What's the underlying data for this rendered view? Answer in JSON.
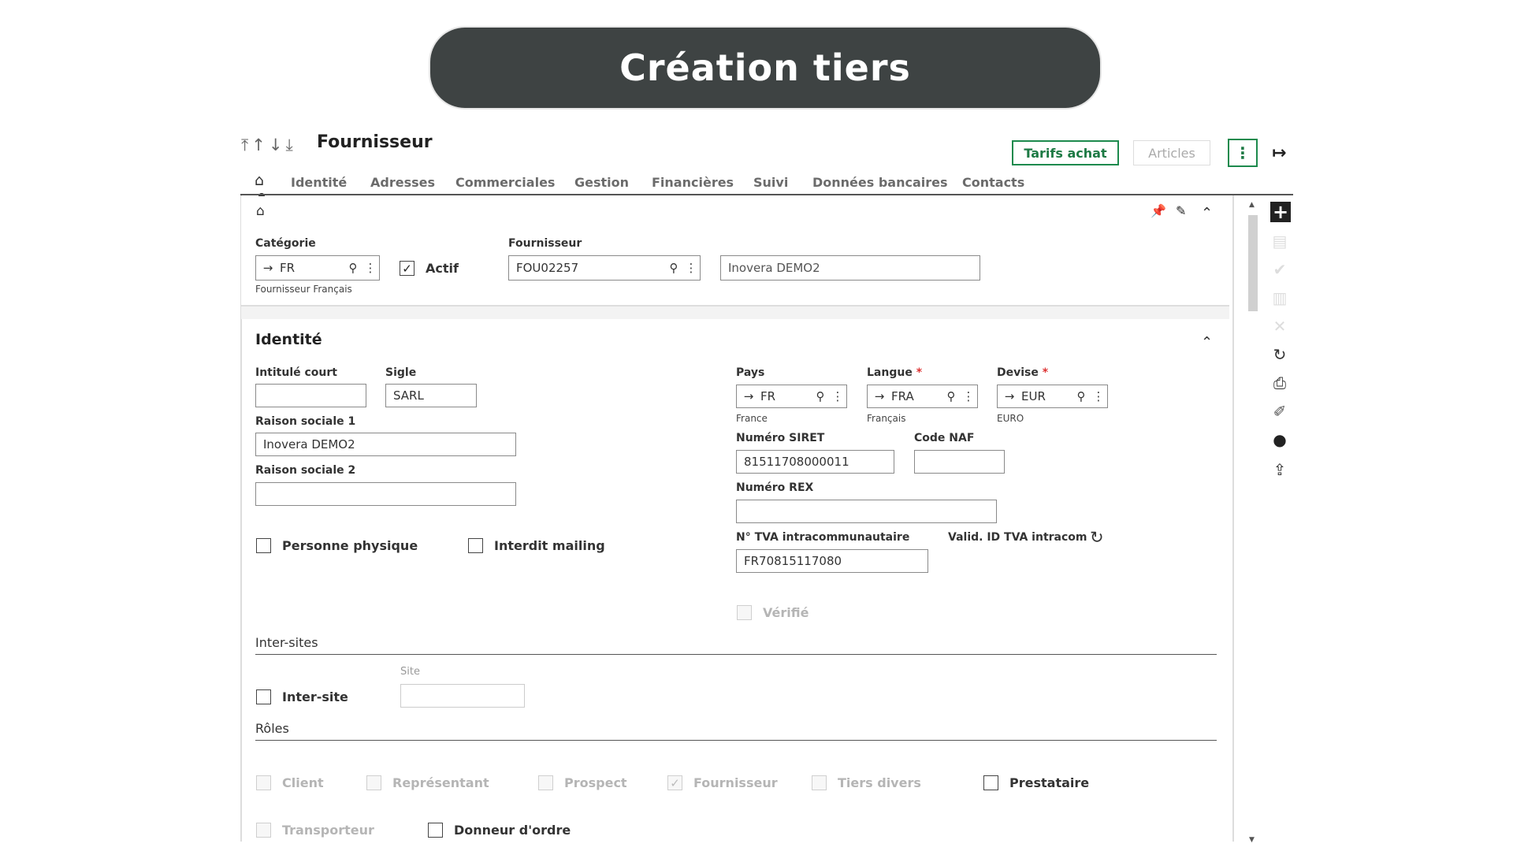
{
  "banner": {
    "title": "Création tiers"
  },
  "header": {
    "nav_arrows": "⤒↑↓⤓",
    "title": "Fournisseur",
    "tarifs_label": "Tarifs achat",
    "articles_label": "Articles",
    "more_icon": "⋮",
    "exit_icon": "↦"
  },
  "tabs": [
    "Identité",
    "Adresses",
    "Commerciales",
    "Gestion",
    "Financières",
    "Suivi",
    "Données bancaires",
    "Contacts"
  ],
  "top_card": {
    "categorie_label": "Catégorie",
    "categorie_value": "FR",
    "categorie_desc": "Fournisseur Français",
    "actif_label": "Actif",
    "actif_checked": true,
    "fournisseur_label": "Fournisseur",
    "fournisseur_value": "FOU02257",
    "fournisseur_name": "Inovera DEMO2"
  },
  "identite": {
    "title": "Identité",
    "intitule_label": "Intitulé court",
    "intitule_value": "",
    "sigle_label": "Sigle",
    "sigle_value": "SARL",
    "raison1_label": "Raison sociale 1",
    "raison1_value": "Inovera DEMO2",
    "raison2_label": "Raison sociale 2",
    "raison2_value": "",
    "personne_label": "Personne physique",
    "mailing_label": "Interdit mailing",
    "pays_label": "Pays",
    "pays_value": "FR",
    "pays_desc": "France",
    "langue_label": "Langue",
    "langue_value": "FRA",
    "langue_desc": "Français",
    "devise_label": "Devise",
    "devise_value": "EUR",
    "devise_desc": "EURO",
    "required_mark": "*",
    "siret_label": "Numéro SIRET",
    "siret_value": "81511708000011",
    "naf_label": "Code NAF",
    "naf_value": "",
    "rex_label": "Numéro REX",
    "rex_value": "",
    "tva_label": "N° TVA intracommunautaire",
    "tva_value": "FR70815117080",
    "valid_label": "Valid. ID TVA intracom",
    "verifie_label": "Vérifié"
  },
  "intersites": {
    "title": "Inter-sites",
    "site_label": "Site",
    "site_value": "",
    "intersite_label": "Inter-site"
  },
  "roles": {
    "title": "Rôles",
    "items": [
      {
        "label": "Client",
        "checked": false,
        "disabled": true
      },
      {
        "label": "Représentant",
        "checked": false,
        "disabled": true
      },
      {
        "label": "Prospect",
        "checked": false,
        "disabled": true
      },
      {
        "label": "Fournisseur",
        "checked": true,
        "disabled": true
      },
      {
        "label": "Tiers divers",
        "checked": false,
        "disabled": true
      },
      {
        "label": "Prestataire",
        "checked": false,
        "disabled": false
      },
      {
        "label": "Transporteur",
        "checked": false,
        "disabled": true
      },
      {
        "label": "Donneur d'ordre",
        "checked": false,
        "disabled": false
      }
    ]
  },
  "icons": {
    "arrow": "→",
    "search": "⚲",
    "more": "⋮",
    "check": "✓",
    "home": "⌂",
    "collapse": "⌃",
    "refresh": "↻"
  }
}
